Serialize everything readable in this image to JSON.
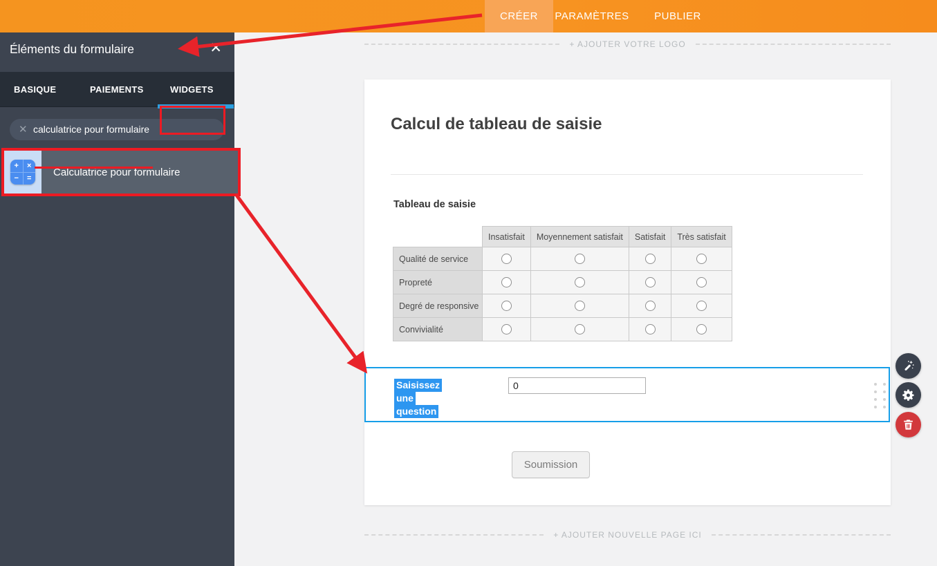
{
  "topbar": {
    "tabs": [
      {
        "label": "CRÉER",
        "active": true
      },
      {
        "label": "PARAMÈTRES",
        "active": false
      },
      {
        "label": "PUBLIER",
        "active": false
      }
    ]
  },
  "sidebar": {
    "title": "Éléments du formulaire",
    "close_icon": "✕",
    "tabs": [
      {
        "label": "BASIQUE",
        "active": false
      },
      {
        "label": "PAIEMENTS",
        "active": false
      },
      {
        "label": "WIDGETS",
        "active": true
      }
    ],
    "search": {
      "value": "calculatrice pour formulaire",
      "clear_icon": "✕"
    },
    "widget_result": {
      "label": "Calculatrice pour formulaire",
      "icon": "calculator-icon",
      "icon_symbols": [
        "+",
        "×",
        "−",
        "="
      ]
    }
  },
  "canvas": {
    "add_logo_label": "+ AJOUTER VOTRE LOGO",
    "add_page_label": "+ AJOUTER NOUVELLE PAGE ICI",
    "form": {
      "title": "Calcul de tableau de saisie",
      "matrix": {
        "label": "Tableau de saisie",
        "columns": [
          "Insatisfait",
          "Moyennement satisfait",
          "Satisfait",
          "Très satisfait"
        ],
        "rows": [
          "Qualité de service",
          "Propreté",
          "Degré de responsive",
          "Convivialité"
        ]
      },
      "calculator_field": {
        "label": "Saisissez une question",
        "value": "0"
      },
      "submit_label": "Soumission"
    }
  },
  "element_actions": [
    {
      "name": "magic-wand"
    },
    {
      "name": "gear"
    },
    {
      "name": "trash"
    }
  ],
  "colors": {
    "topbar_orange": "#f79321",
    "active_tab_orange": "#f8a556",
    "sidebar_dark": "#3d4450",
    "sidebar_tabbar": "#272e37",
    "accent_blue": "#2b9fe0",
    "selection_blue": "#2d96f0",
    "element_border_blue": "#169ee8",
    "annotation_red": "#ec1b23",
    "trash_red": "#d2383c",
    "widget_icon_blue": "#4a8df0"
  }
}
